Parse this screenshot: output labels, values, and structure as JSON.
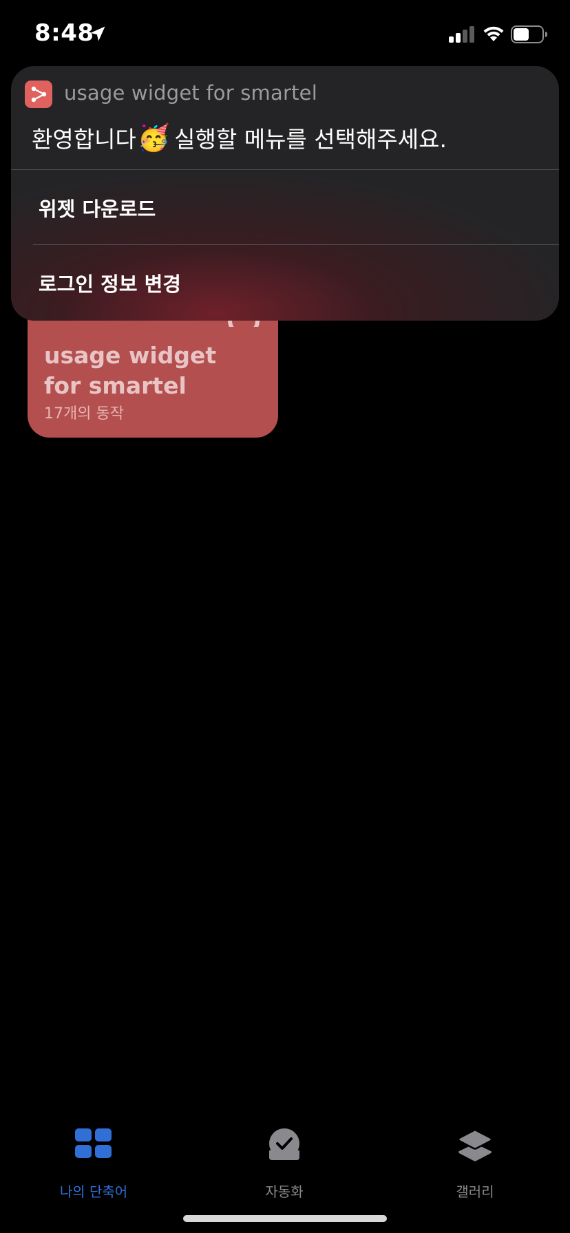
{
  "status_bar": {
    "time": "8:48",
    "location_icon": "location-arrow-icon",
    "signal_icon": "cellular-signal-icon",
    "wifi_icon": "wifi-icon",
    "battery_icon": "battery-icon",
    "battery_level": 0.55
  },
  "menu": {
    "app_name": "usage widget for smartel",
    "prompt_before_emoji": "환영합니다",
    "prompt_emoji": "🥳",
    "prompt_after_emoji": "실행할 메뉴를 선택해주세요.",
    "items": [
      {
        "label": "위젯 다운로드"
      },
      {
        "label": "로그인 정보 변경"
      }
    ],
    "accent_color": "#e0625f"
  },
  "shortcut_card": {
    "title": "usage widget\nfor smartel",
    "subtitle": "17개의 동작",
    "color": "#b34f4f"
  },
  "tab_bar": {
    "tabs": [
      {
        "label": "나의 단축어",
        "icon": "grid-icon",
        "active": true
      },
      {
        "label": "자동화",
        "icon": "clock-check-icon",
        "active": false
      },
      {
        "label": "갤러리",
        "icon": "layers-icon",
        "active": false
      }
    ],
    "active_color": "#2f6fd6",
    "inactive_color": "#8a8a8e"
  }
}
